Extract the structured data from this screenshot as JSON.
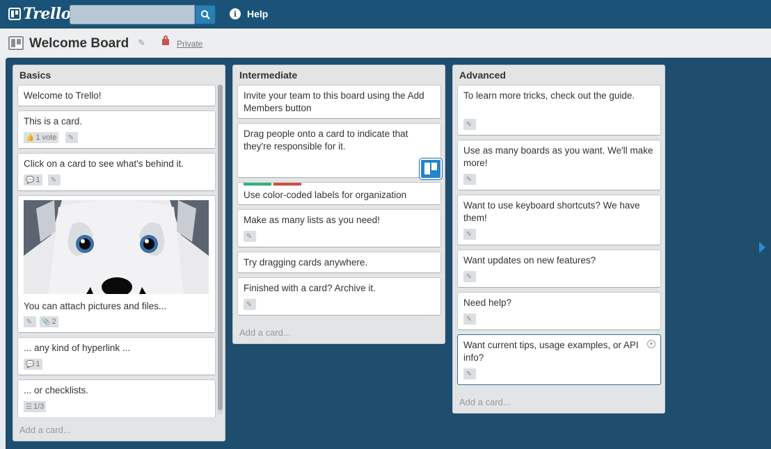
{
  "app": {
    "logo_text": "Trello",
    "help_label": "Help"
  },
  "search": {
    "placeholder": ""
  },
  "board": {
    "title": "Welcome Board",
    "privacy": "Private"
  },
  "lists": [
    {
      "title": "Basics",
      "add_card": "Add a card...",
      "cards": [
        {
          "text": "Welcome to Trello!"
        },
        {
          "text": "This is a card.",
          "vote_badge": "1 vote"
        },
        {
          "text": "Click on a card to see what's behind it.",
          "comment_badge": "1"
        },
        {
          "text": "You can attach pictures and files...",
          "attachment_badge": "2"
        },
        {
          "text": "... any kind of hyperlink ...",
          "comment_badge": "1"
        },
        {
          "text": "... or checklists.",
          "checklist_badge": "1/3"
        }
      ]
    },
    {
      "title": "Intermediate",
      "add_card": "Add a card...",
      "cards": [
        {
          "text": "Invite your team to this board using the Add Members button"
        },
        {
          "text": "Drag people onto a card to indicate that they're responsible for it."
        },
        {
          "text": "Use color-coded labels for organization",
          "labels": [
            "#34b27d",
            "#d24d45"
          ]
        },
        {
          "text": "Make as many lists as you need!"
        },
        {
          "text": "Try dragging cards anywhere."
        },
        {
          "text": "Finished with a card? Archive it."
        }
      ]
    },
    {
      "title": "Advanced",
      "add_card": "Add a card...",
      "cards": [
        {
          "text": "To learn more tricks, check out the guide."
        },
        {
          "text": "Use as many boards as you want. We'll make more!"
        },
        {
          "text": "Want to use keyboard shortcuts? We have them!"
        },
        {
          "text": "Want updates on new features?"
        },
        {
          "text": "Need help?"
        },
        {
          "text": "Want current tips, usage examples, or API info?"
        }
      ]
    }
  ],
  "colors": {
    "topbar": "#1b5378",
    "board_bg": "#1e4d6e",
    "list_bg": "#e2e4e6",
    "label_green": "#34b27d",
    "label_red": "#d24d45",
    "accent_blue": "#2386c7"
  }
}
